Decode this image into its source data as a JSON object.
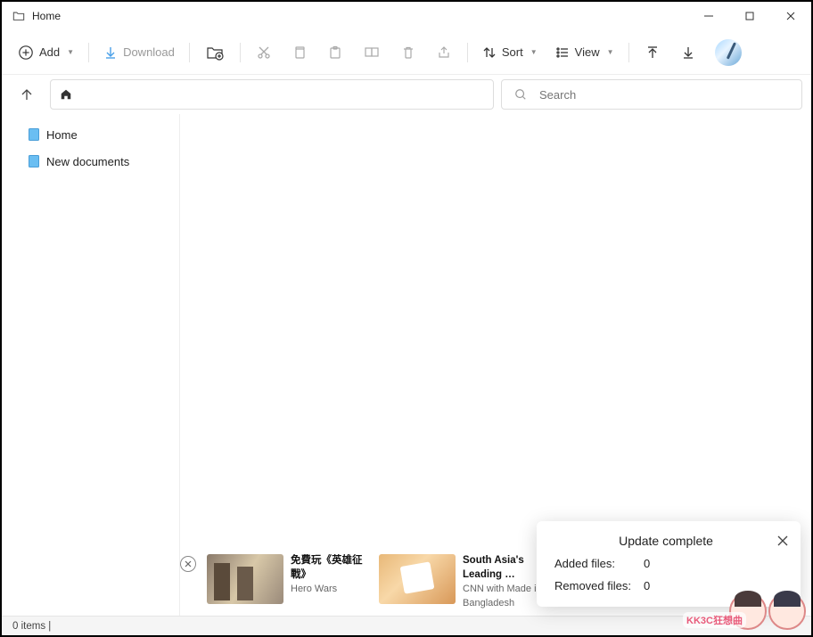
{
  "window": {
    "title": "Home"
  },
  "toolbar": {
    "add": "Add",
    "download": "Download",
    "sort": "Sort",
    "view": "View"
  },
  "search": {
    "placeholder": "Search"
  },
  "sidebar": {
    "items": [
      {
        "label": "Home"
      },
      {
        "label": "New documents"
      }
    ]
  },
  "toast": {
    "title": "Update complete",
    "added_label": "Added files:",
    "added_value": "0",
    "removed_label": "Removed files:",
    "removed_value": "0"
  },
  "ads": [
    {
      "title": "免費玩《英雄征戰》",
      "subtitle": "Hero Wars"
    },
    {
      "title": "South Asia's Leading …",
      "subtitle": "CNN with Made in",
      "subtitle2": "Bangladesh"
    }
  ],
  "status": {
    "text": "0 items |"
  },
  "watermark": "KK3C狂想曲"
}
